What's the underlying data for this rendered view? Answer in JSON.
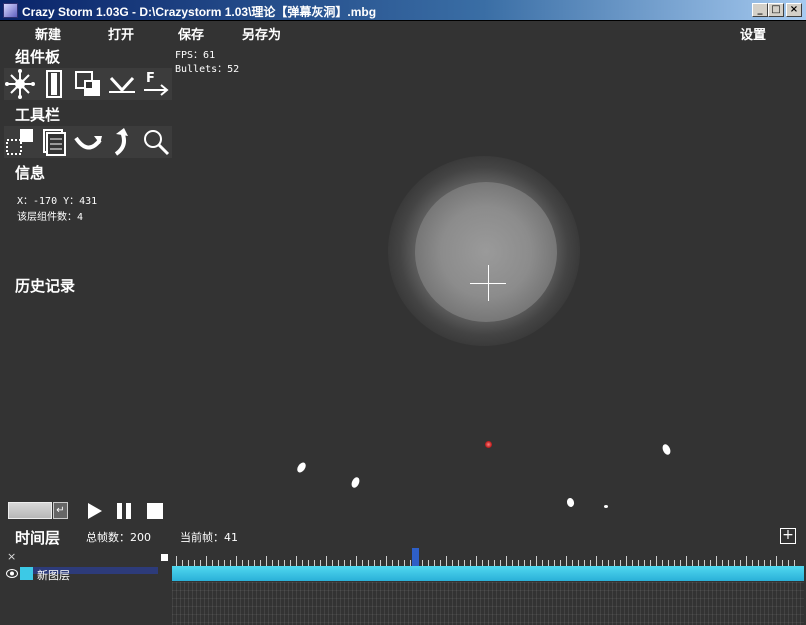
{
  "window": {
    "title": "Crazy Storm 1.03G - D:\\Crazystorm 1.03\\理论【弹幕灰洞】.mbg",
    "minimize": "_",
    "maximize": "□",
    "close": "×"
  },
  "menu": {
    "new": "新建",
    "open": "打开",
    "save": "保存",
    "save_as": "另存为",
    "settings": "设置"
  },
  "panels": {
    "components": "组件板",
    "tools": "工具栏",
    "info": "信息",
    "history": "历史记录"
  },
  "info": {
    "coords": "X：-170  Y：431",
    "layer_components": "该层组件数：4"
  },
  "stats": {
    "fps": "FPS：61",
    "bullets": "Bullets：52"
  },
  "playback": {
    "enter": "↵"
  },
  "timeline": {
    "heading": "时间层",
    "total_frames": "总帧数：200",
    "current_frame": "当前帧：41",
    "add": "+",
    "close": "×",
    "layers": [
      {
        "name": "新图层",
        "color": "#3cc9e6"
      }
    ]
  },
  "colors": {
    "background": "#333333",
    "playhead": "#2e5fc8",
    "track": "#3cc9e6"
  }
}
